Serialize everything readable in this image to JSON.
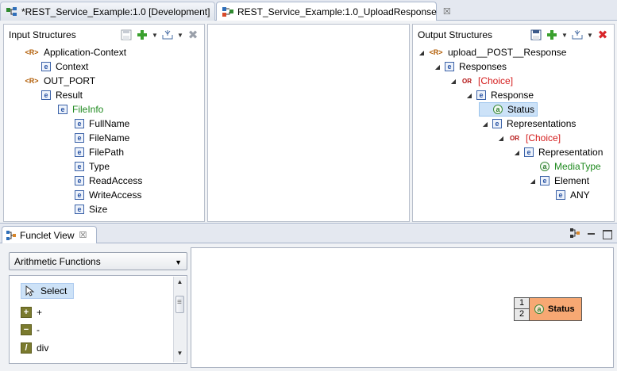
{
  "tabs": [
    {
      "label": "*REST_Service_Example:1.0 [Development]",
      "active": false
    },
    {
      "label": "REST_Service_Example:1.0_UploadResponse",
      "active": true,
      "close": "☒"
    }
  ],
  "input_pane": {
    "title": "Input Structures",
    "tree": [
      {
        "label": "Application-Context",
        "type": "R",
        "level": 0
      },
      {
        "label": "Context",
        "type": "e",
        "level": 1
      },
      {
        "label": "OUT_PORT",
        "type": "R",
        "level": 0
      },
      {
        "label": "Result",
        "type": "e",
        "level": 1
      },
      {
        "label": "FileInfo",
        "type": "e",
        "level": 2,
        "color": "green"
      },
      {
        "label": "FullName",
        "type": "e",
        "level": 3
      },
      {
        "label": "FileName",
        "type": "e",
        "level": 3
      },
      {
        "label": "FilePath",
        "type": "e",
        "level": 3
      },
      {
        "label": "Type",
        "type": "e",
        "level": 3
      },
      {
        "label": "ReadAccess",
        "type": "e",
        "level": 3
      },
      {
        "label": "WriteAccess",
        "type": "e",
        "level": 3
      },
      {
        "label": "Size",
        "type": "e",
        "level": 3
      }
    ]
  },
  "output_pane": {
    "title": "Output Structures",
    "tree": [
      {
        "label": "upload__POST__Response",
        "type": "R",
        "level": 0
      },
      {
        "label": "Responses",
        "type": "e",
        "level": 1
      },
      {
        "label": "[Choice]",
        "type": "OR",
        "level": 2,
        "color": "red"
      },
      {
        "label": "Response",
        "type": "e",
        "level": 3
      },
      {
        "label": "Status",
        "type": "a",
        "level": 4,
        "selected": true
      },
      {
        "label": "Representations",
        "type": "e",
        "level": 4
      },
      {
        "label": "[Choice]",
        "type": "OR",
        "level": 5,
        "color": "red"
      },
      {
        "label": "Representation",
        "type": "e",
        "level": 6
      },
      {
        "label": "MediaType",
        "type": "a",
        "level": 7,
        "color": "green"
      },
      {
        "label": "Element",
        "type": "e",
        "level": 7
      },
      {
        "label": "ANY",
        "type": "e",
        "level": 8
      }
    ]
  },
  "funclet_view": {
    "tab_label": "Funclet View",
    "close": "☒",
    "category": "Arithmetic Functions",
    "palette": [
      {
        "label": "Select",
        "icon": "pointer-icon"
      },
      {
        "label": "+",
        "icon": "plus-icon"
      },
      {
        "label": "-",
        "icon": "minus-icon"
      },
      {
        "label": "div",
        "icon": "divide-icon"
      }
    ],
    "canvas_node": {
      "inputs": [
        "1",
        "2"
      ],
      "label": "Status"
    }
  },
  "badges": {
    "R": "<R>",
    "e": "e",
    "a": "a",
    "OR": "OR"
  }
}
